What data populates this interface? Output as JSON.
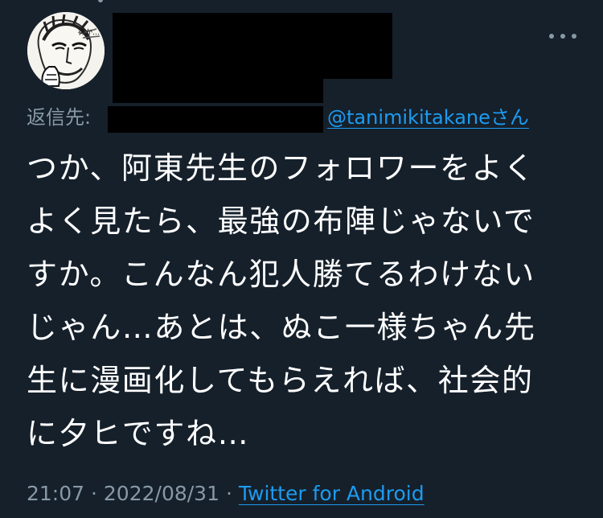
{
  "tweet": {
    "reply_prefix": "返信先:",
    "reply_handle_suffix": "さん",
    "reply_handle": "@tanimikitakane",
    "text_lines": [
      "つか、阿東先生のフォロワーをよく",
      "よく見たら、最強の布陣じゃないで",
      "すか。こんなん犯人勝てるわけない",
      "じゃん…あとは、ぬこ一様ちゃん先",
      "生に漫画化してもらえれば、社会的",
      "に夕ヒですね…"
    ],
    "time": "21:07",
    "separator": "·",
    "date": "2022/08/31",
    "source": "Twitter for Android"
  },
  "icons": {
    "more": "more-horizontal-icon",
    "avatar": "manga-character-avatar"
  },
  "colors": {
    "background": "#15202b",
    "text": "#ffffff",
    "muted": "#8899a6",
    "link": "#1d9bf0",
    "redaction": "#000000"
  }
}
